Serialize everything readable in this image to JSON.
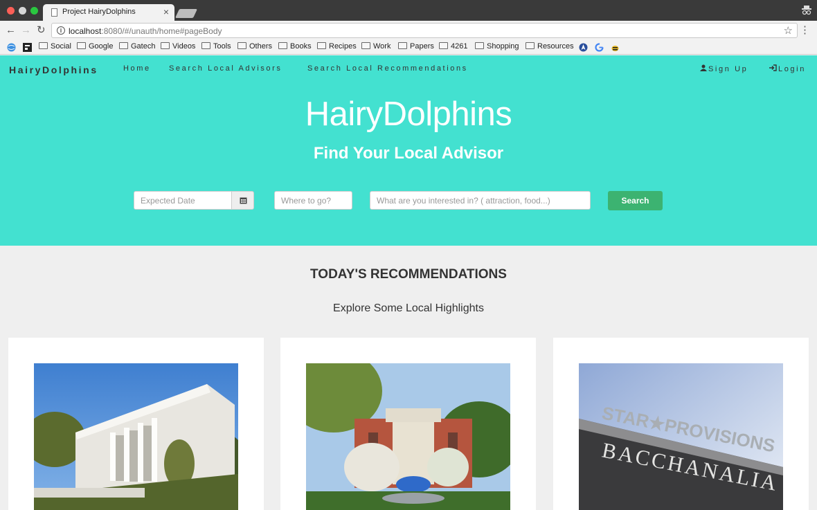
{
  "browser": {
    "tab_title": "Project HairyDolphins",
    "tab_close": "×",
    "url_host": "localhost",
    "url_rest": ":8080/#/unauth/home#pageBody",
    "bookmarks": [
      "Social",
      "Google",
      "Gatech",
      "Videos",
      "Tools",
      "Others",
      "Books",
      "Recipes",
      "Work",
      "Papers",
      "4261",
      "Shopping",
      "Resources"
    ]
  },
  "nav": {
    "brand": "HairyDolphins",
    "links": [
      "Home",
      "Search Local Advisors",
      "Search Local Recommendations"
    ],
    "signup": "Sign Up",
    "login": "Login"
  },
  "hero": {
    "title": "HairyDolphins",
    "subtitle": "Find Your Local Advisor",
    "date_placeholder": "Expected Date",
    "where_placeholder": "Where to go?",
    "interest_placeholder": "What are you interested in? ( attraction, food...)",
    "search_label": "Search"
  },
  "recommendations": {
    "title": "TODAY'S RECOMMENDATIONS",
    "subtitle": "Explore Some Local Highlights",
    "cards": [
      {
        "image": "marble-museum-building-photo"
      },
      {
        "image": "botanical-garden-fountain-photo"
      },
      {
        "image": "star-provisions-bacchanalia-sign-photo",
        "sign_top": "STAR★PROVISIONS",
        "sign_bottom": "BACCHANALIA"
      }
    ]
  },
  "colors": {
    "accent": "#43e1d0",
    "search_button": "#3cb371",
    "page_bg": "#efefef"
  }
}
